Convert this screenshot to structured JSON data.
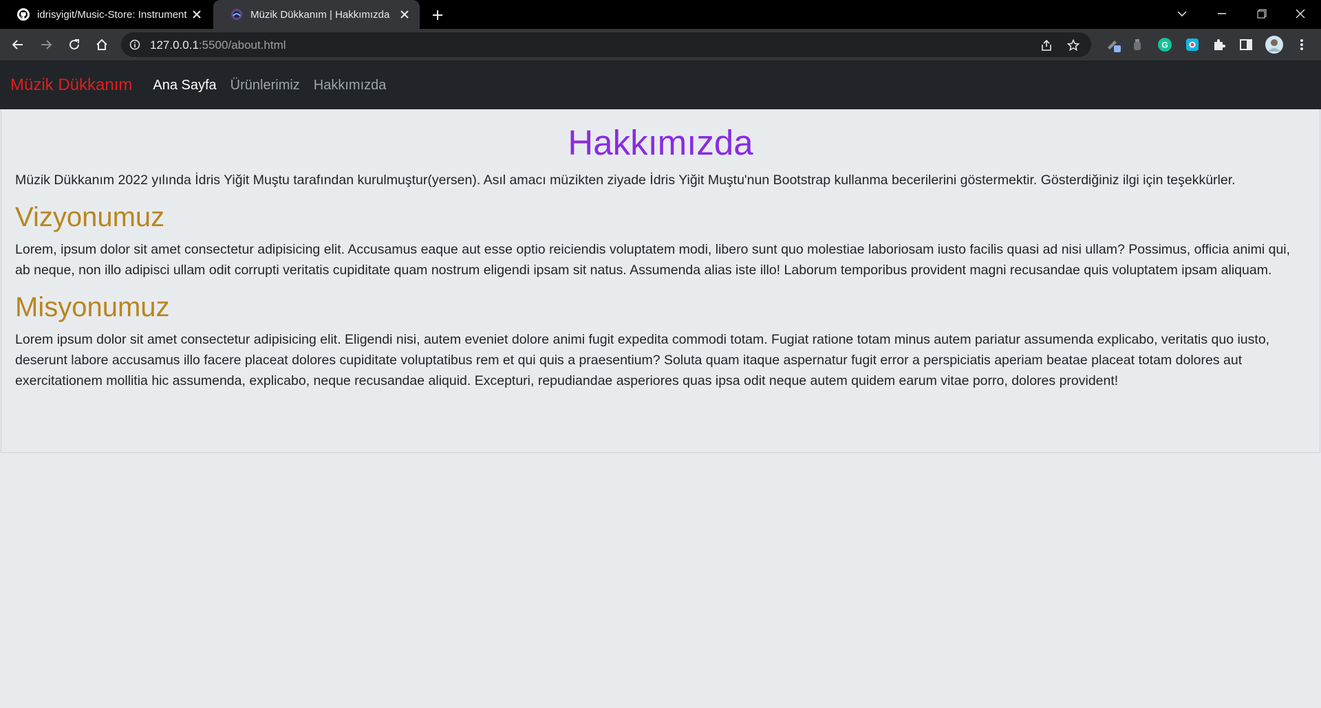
{
  "browser": {
    "tabs": [
      {
        "title": "idrisyigit/Music-Store: Instrument",
        "favicon": "github-icon",
        "active": false
      },
      {
        "title": "Müzik Dükkanım | Hakkımızda",
        "favicon": "vscode-live-server-icon",
        "active": true
      }
    ],
    "url_host": "127.0.0.1",
    "url_rest": ":5500/about.html",
    "colors": {
      "tabstrip": "#000000",
      "toolbar": "#35363a",
      "omnibox": "#202124"
    }
  },
  "navbar": {
    "brand": "Müzik Dükkanım",
    "links": [
      {
        "label": "Ana Sayfa",
        "active": true
      },
      {
        "label": "Ürünlerimiz",
        "active": false
      },
      {
        "label": "Hakkımızda",
        "active": false
      }
    ],
    "colors": {
      "background": "#212529",
      "brand": "#e11d1d"
    }
  },
  "main": {
    "title": "Hakkımızda",
    "intro": "Müzik Dükkanım 2022 yılında İdris Yiğit Muştu tarafından kurulmuştur(yersen). Asıl amacı müzikten ziyade İdris Yiğit Muştu'nun Bootstrap kullanma becerilerini göstermektir. Gösterdiğiniz ilgi için teşekkürler.",
    "sections": [
      {
        "heading": "Vizyonumuz",
        "text": "Lorem, ipsum dolor sit amet consectetur adipisicing elit. Accusamus eaque aut esse optio reiciendis voluptatem modi, libero sunt quo molestiae laboriosam iusto facilis quasi ad nisi ullam? Possimus, officia animi qui, ab neque, non illo adipisci ullam odit corrupti veritatis cupiditate quam nostrum eligendi ipsam sit natus. Assumenda alias iste illo! Laborum temporibus provident magni recusandae quis voluptatem ipsam aliquam."
      },
      {
        "heading": "Misyonumuz",
        "text": "Lorem ipsum dolor sit amet consectetur adipisicing elit. Eligendi nisi, autem eveniet dolore animi fugit expedita commodi totam. Fugiat ratione totam minus autem pariatur assumenda explicabo, veritatis quo iusto, deserunt labore accusamus illo facere placeat dolores cupiditate voluptatibus rem et qui quis a praesentium? Soluta quam itaque aspernatur fugit error a perspiciatis aperiam beatae placeat totam dolores aut exercitationem mollitia hic assumenda, explicabo, neque recusandae aliquid. Excepturi, repudiandae asperiores quas ipsa odit neque autem quidem earum vitae porro, dolores provident!"
      }
    ],
    "colors": {
      "title": "#8a2be2",
      "section_heading": "#b8861f",
      "text": "#212529"
    }
  }
}
